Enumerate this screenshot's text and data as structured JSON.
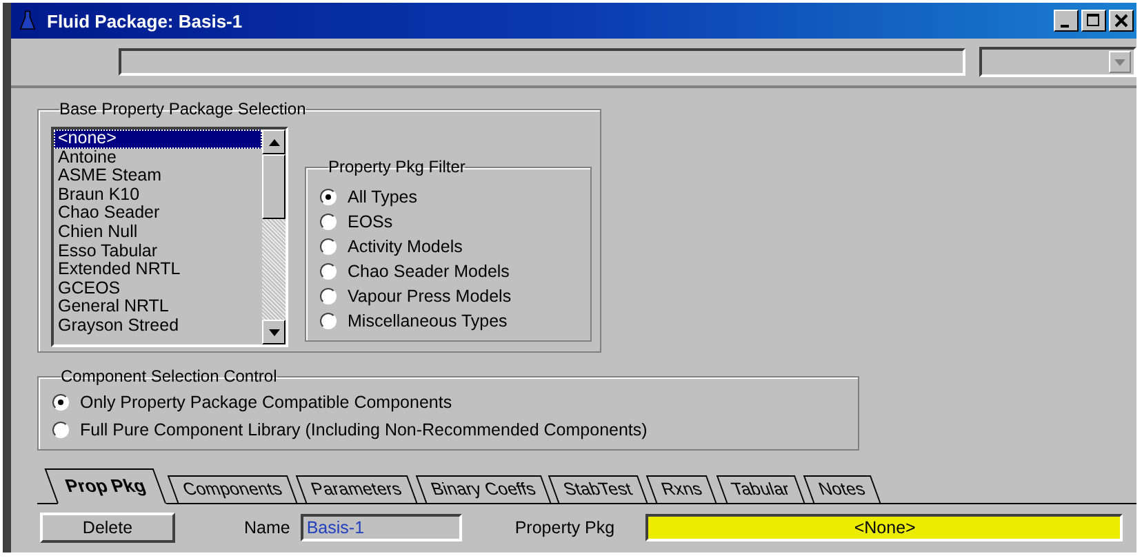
{
  "window": {
    "title": "Fluid Package: Basis-1"
  },
  "base_selection": {
    "title": "Base Property Package Selection",
    "packages": [
      {
        "label": "<none>",
        "selected": true
      },
      {
        "label": "Antoine",
        "selected": false
      },
      {
        "label": "ASME Steam",
        "selected": false
      },
      {
        "label": "Braun K10",
        "selected": false
      },
      {
        "label": "Chao Seader",
        "selected": false
      },
      {
        "label": "Chien Null",
        "selected": false
      },
      {
        "label": "Esso Tabular",
        "selected": false
      },
      {
        "label": "Extended NRTL",
        "selected": false
      },
      {
        "label": "GCEOS",
        "selected": false
      },
      {
        "label": "General NRTL",
        "selected": false
      },
      {
        "label": "Grayson Streed",
        "selected": false
      }
    ],
    "filter": {
      "title": "Property Pkg Filter",
      "options": [
        {
          "label": "All Types",
          "selected": true
        },
        {
          "label": "EOSs",
          "selected": false
        },
        {
          "label": "Activity Models",
          "selected": false
        },
        {
          "label": "Chao Seader Models",
          "selected": false
        },
        {
          "label": "Vapour Press Models",
          "selected": false
        },
        {
          "label": "Miscellaneous Types",
          "selected": false
        }
      ]
    }
  },
  "component_selection": {
    "title": "Component Selection Control",
    "options": [
      {
        "label": "Only Property Package Compatible Components",
        "selected": true
      },
      {
        "label": "Full Pure Component Library (Including Non-Recommended Components)",
        "selected": false
      }
    ]
  },
  "tabs": [
    {
      "label": "Prop Pkg",
      "selected": true
    },
    {
      "label": "Components",
      "selected": false
    },
    {
      "label": "Parameters",
      "selected": false
    },
    {
      "label": "Binary Coeffs",
      "selected": false
    },
    {
      "label": "StabTest",
      "selected": false
    },
    {
      "label": "Rxns",
      "selected": false
    },
    {
      "label": "Tabular",
      "selected": false
    },
    {
      "label": "Notes",
      "selected": false
    }
  ],
  "footer": {
    "button": "Delete",
    "name_label": "Name",
    "name_value": "Basis-1",
    "pkg_label": "Property Pkg",
    "pkg_value": "<None>"
  }
}
